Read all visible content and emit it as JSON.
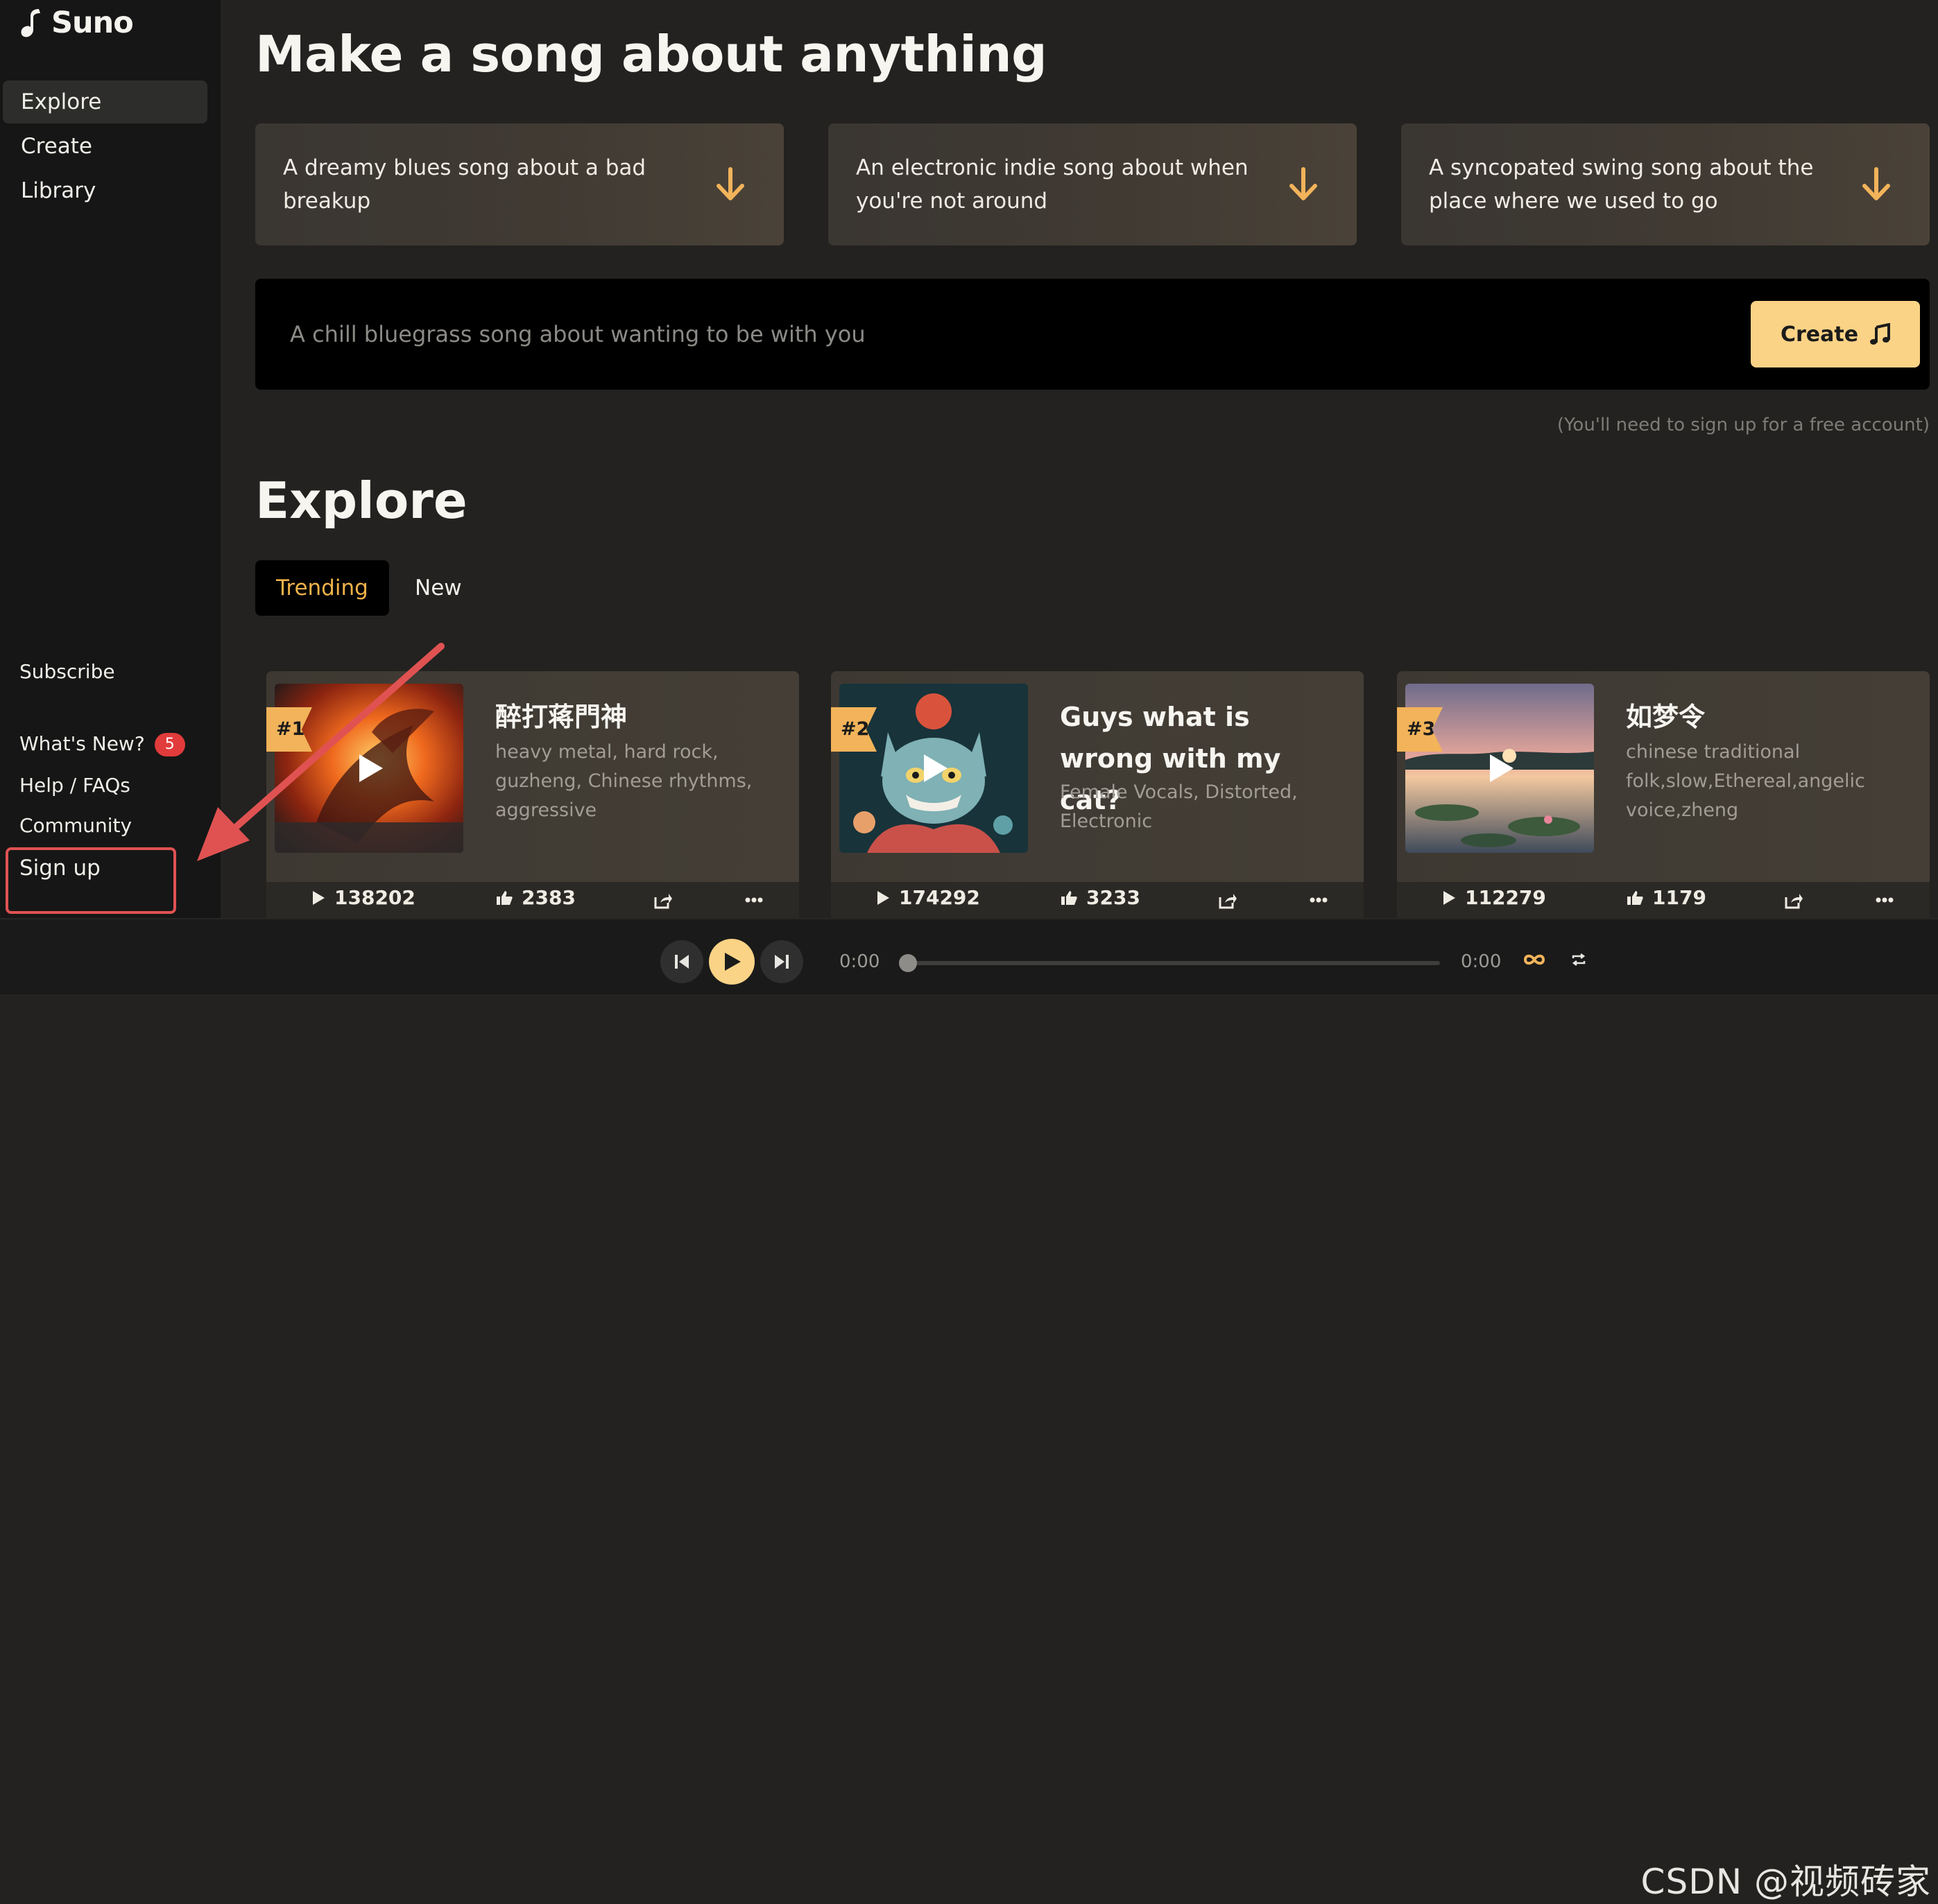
{
  "app": {
    "logo_text": "Suno"
  },
  "sidebar": {
    "nav": [
      {
        "label": "Explore",
        "active": true
      },
      {
        "label": "Create",
        "active": false
      },
      {
        "label": "Library",
        "active": false
      }
    ],
    "subscribe": "Subscribe",
    "whats_new": "What's New?",
    "whats_new_badge": "5",
    "help": "Help / FAQs",
    "community": "Community",
    "sign_up": "Sign up"
  },
  "hero": {
    "title": "Make a song about anything",
    "suggestions": [
      "A dreamy blues song about a bad breakup",
      "An electronic indie song about when you're not around",
      "A syncopated swing song about the place where we used to go"
    ],
    "prompt_placeholder": "A chill bluegrass song about wanting to be with you",
    "create_label": "Create",
    "note": "(You'll need to sign up for a free account)"
  },
  "explore": {
    "title": "Explore",
    "tabs": [
      {
        "label": "Trending",
        "active": true
      },
      {
        "label": "New",
        "active": false
      }
    ],
    "cards": [
      {
        "rank": "#1",
        "title": "醉打蒋門神",
        "tags": "heavy metal, hard rock, guzheng, Chinese rhythms, aggressive",
        "plays": "138202",
        "likes": "2383"
      },
      {
        "rank": "#2",
        "title": "Guys what is wrong with my cat?",
        "tags": "Female Vocals, Distorted, Electronic",
        "plays": "174292",
        "likes": "3233"
      },
      {
        "rank": "#3",
        "title": "如梦令",
        "tags": "chinese traditional folk,slow,Ethereal,angelic voice,zheng",
        "plays": "112279",
        "likes": "1179"
      }
    ]
  },
  "player": {
    "current_time": "0:00",
    "duration": "0:00",
    "progress": 0
  },
  "watermark": "CSDN @视频砖家",
  "colors": {
    "accent": "#fbd386",
    "rank_tag": "#f2b35a",
    "trending_text": "#f0b24a",
    "annotation": "#e05252",
    "badge": "#e23b3b"
  }
}
